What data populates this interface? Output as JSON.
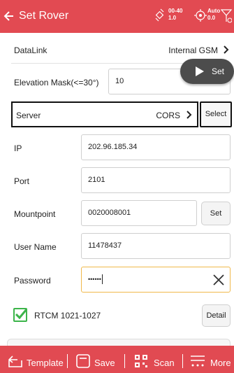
{
  "header": {
    "title": "Set Rover",
    "sat_status": "00-40\n1.0",
    "fix_status": "Auto\n0.0"
  },
  "datalink": {
    "label": "DataLink",
    "value": "Internal GSM"
  },
  "elevation": {
    "label": "Elevation Mask(<=30°)",
    "value": "10"
  },
  "set_fab_label": "Set",
  "server": {
    "label": "Server",
    "value": "CORS",
    "select_label": "Select"
  },
  "ip": {
    "label": "IP",
    "value": "202.96.185.34"
  },
  "port": {
    "label": "Port",
    "value": "2101"
  },
  "mountpoint": {
    "label": "Mountpoint",
    "value": "0020008001",
    "set_label": "Set"
  },
  "username": {
    "label": "User Name",
    "value": "11478437"
  },
  "password": {
    "label": "Password",
    "value": "••••••"
  },
  "rtcm": {
    "label": "RTCM 1021-1027",
    "checked": true,
    "detail_label": "Detail"
  },
  "toolbar": {
    "template_label": "Template",
    "save_label": "Save",
    "scan_label": "Scan",
    "more_label": "More"
  },
  "colors": {
    "accent": "#e14a52",
    "checkbox": "#3cb44a",
    "highlight_border": "#f0b84a"
  }
}
